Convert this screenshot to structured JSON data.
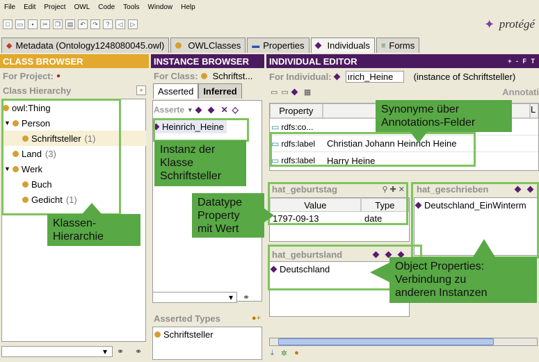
{
  "menu": [
    "File",
    "Edit",
    "Project",
    "OWL",
    "Code",
    "Tools",
    "Window",
    "Help"
  ],
  "logo_text": "protégé",
  "tabs": [
    {
      "label": "Metadata (Ontology1248080045.owl)",
      "icon": "metadata-icon"
    },
    {
      "label": "OWLClasses",
      "icon": "class-icon"
    },
    {
      "label": "Properties",
      "icon": "property-icon"
    },
    {
      "label": "Individuals",
      "icon": "individual-icon"
    },
    {
      "label": "Forms",
      "icon": "form-icon"
    }
  ],
  "class_browser": {
    "title": "CLASS BROWSER",
    "for_project": "For Project:",
    "hierarchy_label": "Class Hierarchy",
    "tree": [
      {
        "label": "owl:Thing",
        "count": ""
      },
      {
        "label": "Person",
        "count": ""
      },
      {
        "label": "Schriftsteller",
        "count": "(1)"
      },
      {
        "label": "Land",
        "count": "(3)"
      },
      {
        "label": "Werk",
        "count": ""
      },
      {
        "label": "Buch",
        "count": ""
      },
      {
        "label": "Gedicht",
        "count": "(1)"
      }
    ]
  },
  "instance_browser": {
    "title": "INSTANCE BROWSER",
    "for_class_label": "For Class:",
    "for_class_value": "Schriftst...",
    "tab_asserted": "Asserted",
    "tab_inferred": "Inferred",
    "list_header": "Asserte",
    "instances": [
      "Heinrich_Heine"
    ],
    "asserted_types_title": "Asserted Types",
    "asserted_types": [
      "Schriftsteller"
    ]
  },
  "individual_editor": {
    "title": "INDIVIDUAL EDITOR",
    "header_controls": "+ - F T",
    "for_individual_label": "For Individual:",
    "individual_value": "ırich_Heine",
    "instance_of": "(instance of Schriftsteller)",
    "annotations_label": "Annotati",
    "annotation_columns": [
      "Property",
      "",
      "L"
    ],
    "annotation_rows": [
      {
        "property": "rdfs:co...",
        "value": ""
      },
      {
        "property": "rdfs:label",
        "value": "Christian Johann Heinrich Heine"
      },
      {
        "property": "rdfs:label",
        "value": "Harry Heine"
      }
    ],
    "geburtstag": {
      "title": "hat_geburtstag",
      "columns": [
        "Value",
        "Type"
      ],
      "rows": [
        {
          "value": "1797-09-13",
          "type": "date"
        }
      ]
    },
    "geschrieben": {
      "title": "hat_geschrieben",
      "items": [
        "Deutschland_EinWinterm"
      ]
    },
    "geburtsland": {
      "title": "hat_geburtsland",
      "items": [
        "Deutschland"
      ]
    }
  },
  "callouts": {
    "klassen": "Klassen-\nHierarchie",
    "instanz": "Instanz der\nKlasse\nSchriftsteller",
    "synonyme": "Synonyme über\nAnnotations-Felder",
    "datatype": "Datatype\nProperty\nmit Wert",
    "object": "Object Properties:\nVerbindung zu\nanderen Instanzen"
  },
  "colors": {
    "header_purple": "#4b1a5e",
    "header_gold": "#e2a92d",
    "callout_green": "#58a845",
    "highlight_border": "#7fc35e",
    "class_dot": "#d4a032",
    "individual_diamond": "#5a1c6d"
  }
}
